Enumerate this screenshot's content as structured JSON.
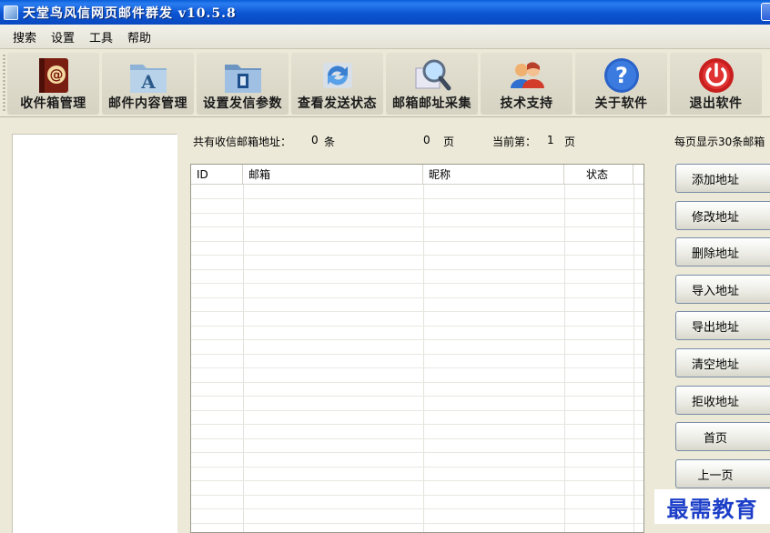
{
  "window": {
    "title": "天堂鸟风信网页邮件群发  v10.5.8"
  },
  "menu": [
    "搜索",
    "设置",
    "工具",
    "帮助"
  ],
  "toolbar": [
    {
      "label": "收件箱管理",
      "icon": "address-book-icon"
    },
    {
      "label": "邮件内容管理",
      "icon": "folder-a-icon"
    },
    {
      "label": "设置发信参数",
      "icon": "folder-settings-icon"
    },
    {
      "label": "查看发送状态",
      "icon": "refresh-arrows-icon"
    },
    {
      "label": "邮箱邮址采集",
      "icon": "magnifier-icon"
    },
    {
      "label": "技术支持",
      "icon": "users-icon"
    },
    {
      "label": "关于软件",
      "icon": "help-icon"
    },
    {
      "label": "退出软件",
      "icon": "power-icon"
    }
  ],
  "status": {
    "total_label": "共有收信邮箱地址：",
    "total_count": "0",
    "total_unit": "条",
    "pages": "0",
    "pages_unit": "页",
    "current_label": "当前第：",
    "current_page": "1",
    "current_unit": "页",
    "per_page": "每页显示30条邮箱"
  },
  "table": {
    "columns": [
      "ID",
      "邮箱",
      "昵称",
      "状态"
    ],
    "rows": []
  },
  "side_buttons": [
    "添加地址",
    "修改地址",
    "删除地址",
    "导入地址",
    "导出地址",
    "清空地址",
    "拒收地址",
    "首页",
    "上一页"
  ],
  "watermark": "最需教育",
  "colors": {
    "titlebar": "#0b55d3",
    "window_bg": "#ece9d8",
    "watermark": "#1d3fc8"
  }
}
